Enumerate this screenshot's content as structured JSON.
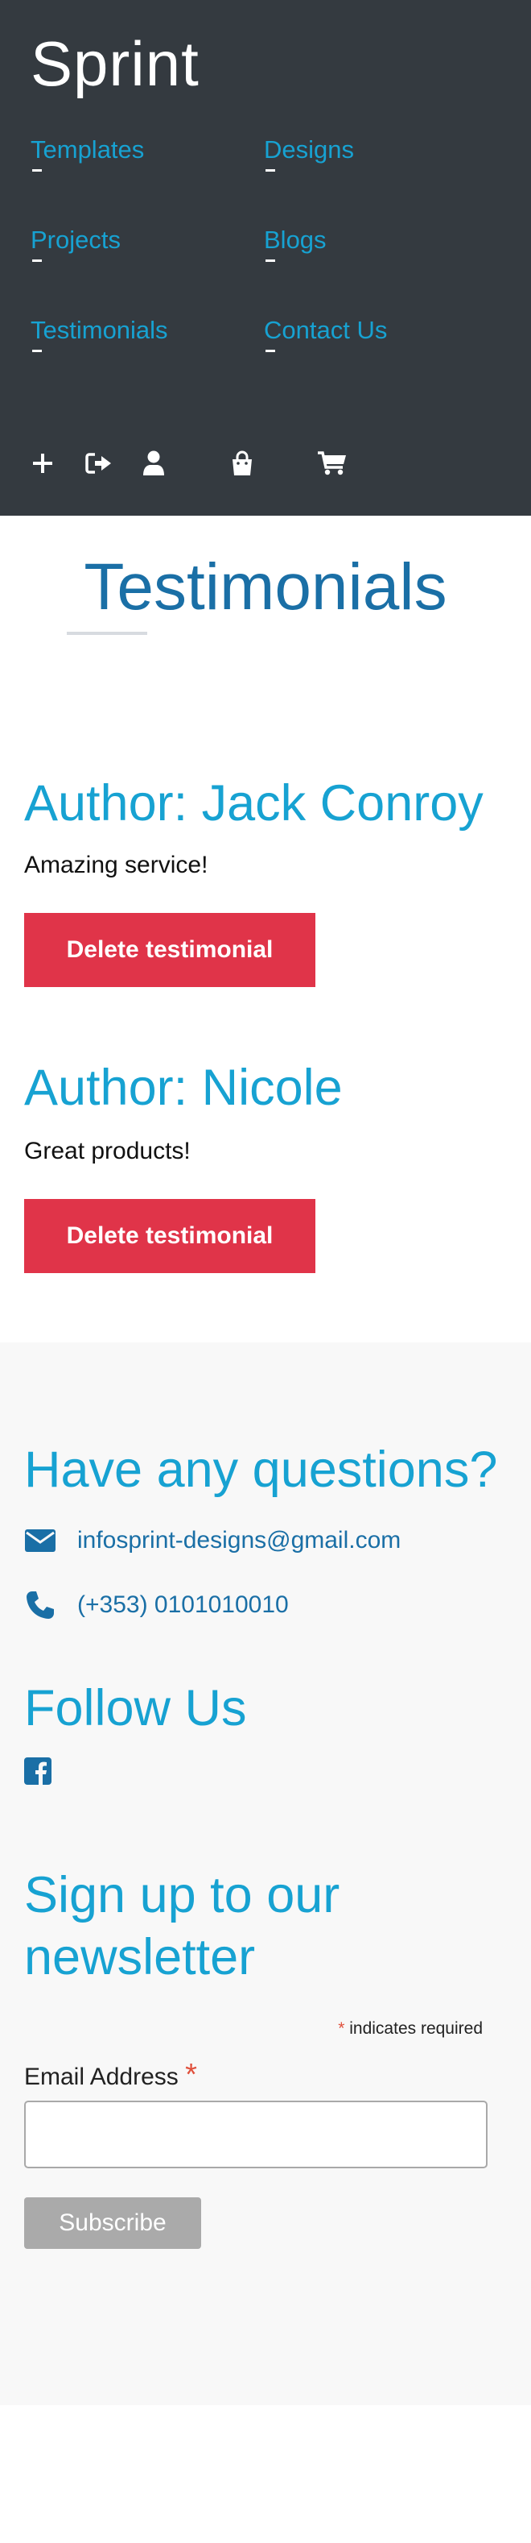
{
  "header": {
    "brand": "Sprint",
    "nav": [
      {
        "label": "Templates"
      },
      {
        "label": "Designs"
      },
      {
        "label": "Projects"
      },
      {
        "label": "Blogs"
      },
      {
        "label": "Testimonials"
      },
      {
        "label": "Contact Us"
      }
    ],
    "toolbar_icons": [
      "plus-icon",
      "sign-out-icon",
      "user-icon",
      "shopping-bag-icon",
      "cart-icon"
    ]
  },
  "testimonials": {
    "title": "Testimonials",
    "items": [
      {
        "author": "Author: Jack Conroy",
        "text": "Amazing service!",
        "delete_label": "Delete testimonial"
      },
      {
        "author": "Author: Nicole",
        "text": "Great products!",
        "delete_label": "Delete testimonial"
      }
    ]
  },
  "footer": {
    "questions_title": "Have any questions?",
    "email": "infosprint-designs@gmail.com",
    "phone": "(+353) 0101010010",
    "follow_title": "Follow Us",
    "social_icons": [
      "facebook-icon"
    ],
    "newsletter_title": "Sign up to our newsletter",
    "required_note": "indicates required",
    "required_star": "*",
    "email_label": "Email Address",
    "email_value": "",
    "subscribe_label": "Subscribe"
  },
  "colors": {
    "header_bg": "#343a40",
    "accent_cyan": "#17a2d2",
    "accent_blue": "#1a6fa6",
    "delete_red": "#e03449",
    "footer_bg": "#f8f8f8",
    "subscribe_gray": "#aaaaaa"
  }
}
